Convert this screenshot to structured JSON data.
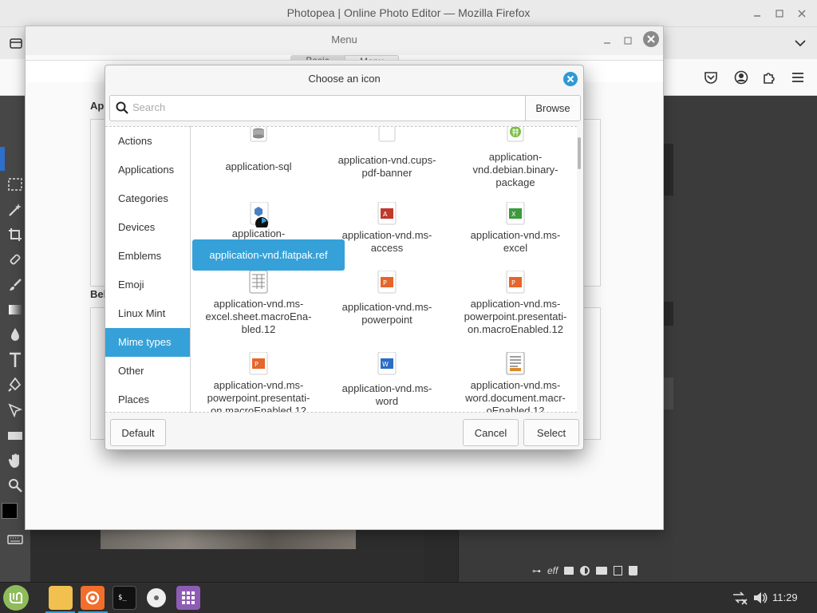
{
  "firefox": {
    "title": "Photopea | Online Photo Editor — Mozilla Firefox"
  },
  "menu_window": {
    "title": "Menu",
    "tabs": [
      "Basic",
      "Menu"
    ],
    "section_applet": "Applet",
    "section_behavior": "Behavior"
  },
  "dialog": {
    "title": "Choose an icon",
    "search": {
      "placeholder": "Search",
      "value": ""
    },
    "browse_label": "Browse",
    "categories": [
      "Actions",
      "Applications",
      "Categories",
      "Devices",
      "Emblems",
      "Emoji",
      "Linux Mint",
      "Mime types",
      "Other",
      "Places"
    ],
    "selected_category": "Mime types",
    "icons": [
      {
        "label": "application-sql",
        "icon": "database-icon"
      },
      {
        "label": "application-vnd.cups-\npdf-banner",
        "icon": "blank-doc-icon"
      },
      {
        "label": "application-\nvnd.debian.binary-\npackage",
        "icon": "debian-package-icon"
      },
      {
        "label": "application-",
        "icon": "flatpak-icon"
      },
      {
        "label": "application-vnd.ms-\naccess",
        "icon": "ms-access-icon"
      },
      {
        "label": "application-vnd.ms-\nexcel",
        "icon": "ms-excel-icon"
      },
      {
        "label": "application-vnd.ms-\nexcel.sheet.macroEna-\nbled.12",
        "icon": "spreadsheet-icon"
      },
      {
        "label": "application-vnd.ms-\npowerpoint",
        "icon": "ms-powerpoint-icon"
      },
      {
        "label": "application-vnd.ms-\npowerpoint.presentati-\non.macroEnabled.12",
        "icon": "ms-powerpoint-icon"
      },
      {
        "label": "application-vnd.ms-\npowerpoint.presentati-\non.macroEnabled.12",
        "icon": "ms-powerpoint-icon"
      },
      {
        "label": "application-vnd.ms-\nword",
        "icon": "ms-word-icon"
      },
      {
        "label": "application-vnd.ms-\nword.document.macr-\noEnabled.12",
        "icon": "document-icon"
      }
    ],
    "tooltip": "application-vnd.flatpak.ref",
    "buttons": {
      "default": "Default",
      "cancel": "Cancel",
      "select": "Select"
    }
  },
  "photopea": {
    "right_icon_text": "eff"
  },
  "taskbar": {
    "clock": "11:29"
  },
  "colors": {
    "accent": "#35a1d8",
    "close": "#2d9ad6",
    "taskbar": "#2e2e2e",
    "mint": "#8fbc5a"
  }
}
